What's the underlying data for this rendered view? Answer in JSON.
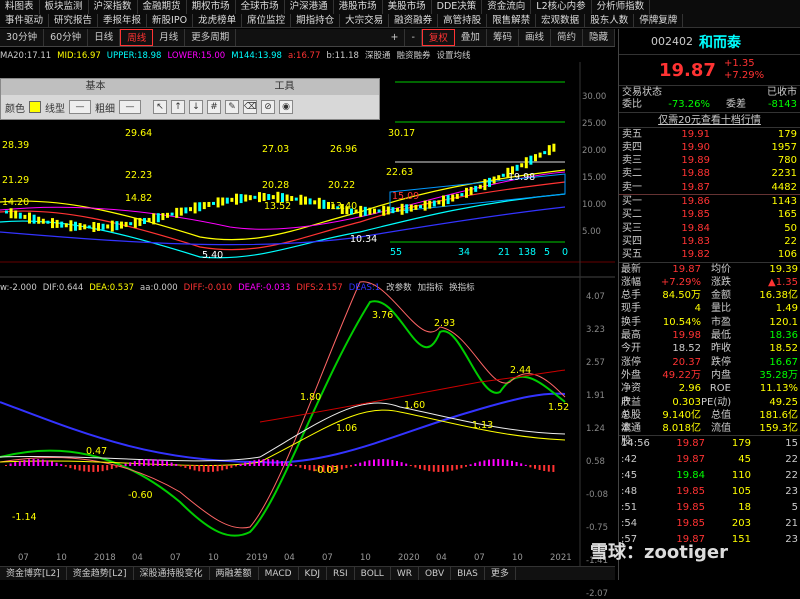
{
  "topnav": {
    "row1": [
      "料图表",
      "板块监测",
      "沪深指数",
      "金融期货",
      "期权市场",
      "全球市场",
      "沪深港通",
      "港股市场",
      "美股市场",
      "DDE决策",
      "资金流向",
      "L2核心内参",
      "分析师指数"
    ],
    "row2": [
      "事件驱动",
      "研究报告",
      "季报年报",
      "新股IPO",
      "龙虎榜单",
      "席位监控",
      "期指持仓",
      "大宗交易",
      "融资融券",
      "高管持股",
      "限售解禁",
      "宏观数据",
      "股东人数",
      "停牌复牌"
    ]
  },
  "toolbar": {
    "left": [
      "30分钟",
      "60分钟",
      "日线",
      "周线",
      "月线",
      "更多周期"
    ],
    "active": "周线",
    "right": [
      "+",
      "-",
      "复权",
      "叠加",
      "筹码",
      "画线",
      "简约",
      "隐藏"
    ],
    "right_active": "复权"
  },
  "indicators": {
    "ma_line": [
      "MA20:17.11",
      "MID:16.97",
      "UPPER:18.98",
      "LOWER:15.00",
      "M144:13.98",
      "a:16.77",
      "b:11.18",
      "深股通",
      "融资融券",
      "设置均线"
    ]
  },
  "draw_panel": {
    "tab1": "基本",
    "tab2": "工具",
    "color_label": "颜色",
    "line_label": "线型",
    "thick_label": "粗细"
  },
  "stock": {
    "code": "002402",
    "name": "和而泰",
    "price": "19.87",
    "change": "+1.35",
    "pct": "+7.29%",
    "status_label": "交易状态",
    "status": "已收市",
    "wb_label": "委比",
    "wb": "-73.26%",
    "wc_label": "委差",
    "wc": "-8143",
    "notice": "仅需20元查看十档行情"
  },
  "asks": [
    {
      "l": "卖五",
      "p": "19.91",
      "v": "179"
    },
    {
      "l": "卖四",
      "p": "19.90",
      "v": "1957"
    },
    {
      "l": "卖三",
      "p": "19.89",
      "v": "780"
    },
    {
      "l": "卖二",
      "p": "19.88",
      "v": "2231"
    },
    {
      "l": "卖一",
      "p": "19.87",
      "v": "4482"
    }
  ],
  "bids": [
    {
      "l": "买一",
      "p": "19.86",
      "v": "1143"
    },
    {
      "l": "买二",
      "p": "19.85",
      "v": "165"
    },
    {
      "l": "买三",
      "p": "19.84",
      "v": "50"
    },
    {
      "l": "买四",
      "p": "19.83",
      "v": "22"
    },
    {
      "l": "买五",
      "p": "19.82",
      "v": "106"
    }
  ],
  "stats": [
    {
      "k": "最新",
      "a": "19.87",
      "k2": "均价",
      "b": "19.39"
    },
    {
      "k": "涨幅",
      "a": "+7.29%",
      "k2": "涨跌",
      "b": "▲1.35"
    },
    {
      "k": "总手",
      "a": "84.50万",
      "k2": "金额",
      "b": "16.38亿"
    },
    {
      "k": "现手",
      "a": "4",
      "k2": "量比",
      "b": "1.49"
    },
    {
      "k": "换手",
      "a": "10.54%",
      "k2": "市盈",
      "b": "120.1"
    },
    {
      "k": "最高",
      "a": "19.98",
      "k2": "最低",
      "b": "18.36"
    },
    {
      "k": "今开",
      "a": "18.52",
      "k2": "昨收",
      "b": "18.52"
    },
    {
      "k": "涨停",
      "a": "20.37",
      "k2": "跌停",
      "b": "16.67"
    },
    {
      "k": "外盘",
      "a": "49.22万",
      "k2": "内盘",
      "b": "35.28万"
    },
    {
      "k": "净资产",
      "a": "2.96",
      "k2": "ROE",
      "b": "11.13%"
    },
    {
      "k": "收益①",
      "a": "0.303",
      "k2": "PE(动)",
      "b": "49.25"
    },
    {
      "k": "总股本",
      "a": "9.140亿",
      "k2": "总值",
      "b": "181.6亿"
    },
    {
      "k": "流通股",
      "a": "8.018亿",
      "k2": "流值",
      "b": "159.3亿"
    }
  ],
  "ticks": [
    {
      "tm": "14:56",
      "pr": "19.87",
      "vo": "179",
      "n": "15"
    },
    {
      "tm": ":42",
      "pr": "19.87",
      "vo": "45",
      "n": "22"
    },
    {
      "tm": ":45",
      "pr": "19.84",
      "vo": "110",
      "n": "22"
    },
    {
      "tm": ":48",
      "pr": "19.85",
      "vo": "105",
      "n": "23"
    },
    {
      "tm": ":51",
      "pr": "19.85",
      "vo": "18",
      "n": "5"
    },
    {
      "tm": ":54",
      "pr": "19.85",
      "vo": "203",
      "n": "21"
    },
    {
      "tm": ":57",
      "pr": "19.87",
      "vo": "151",
      "n": "23"
    }
  ],
  "chart_labels": {
    "main": [
      "29.64",
      "28.39",
      "27.03",
      "26.96",
      "30.17",
      "22.23",
      "21.29",
      "20.28",
      "20.22",
      "22.63",
      "14.82",
      "14.20",
      "13.52",
      "13.40",
      "15.09",
      "19.98",
      "5.40",
      "10.34",
      "55",
      "34",
      "21",
      "13",
      "8",
      "5",
      "0"
    ],
    "y_main": [
      "30.00",
      "25.00",
      "20.00",
      "15.00",
      "10.00",
      "5.00"
    ],
    "macd_line": [
      "w:-2.000",
      "DIF:0.644",
      "DEA:0.537",
      "aa:0.000",
      "DIFF:-0.010",
      "DEAF:-0.033",
      "DIFS:2.157",
      "DEAS:1",
      "改参数",
      "加指标",
      "换指标"
    ],
    "y_macd": [
      "4.07",
      "3.23",
      "2.57",
      "1.91",
      "1.24",
      "0.58",
      "-0.08",
      "-0.75",
      "-1.41",
      "-2.07"
    ],
    "macd_vals": [
      "3.76",
      "2.93",
      "2.44",
      "1.80",
      "1.60",
      "1.06",
      "1.13",
      "1.52",
      "0.47",
      "-0.60",
      "-1.14",
      "-0.03"
    ],
    "x": [
      "07",
      "10",
      "2018",
      "04",
      "07",
      "10",
      "2019",
      "04",
      "07",
      "10",
      "2020",
      "04",
      "07",
      "10",
      "2021"
    ]
  },
  "bottombar": [
    "资金博弈[L2]",
    "资金趋势[L2]",
    "深股通持股变化",
    "两融差额",
    "MACD",
    "KDJ",
    "RSI",
    "BOLL",
    "WR",
    "OBV",
    "BIAS",
    "更多"
  ],
  "watermark": "雪球：zootiger"
}
